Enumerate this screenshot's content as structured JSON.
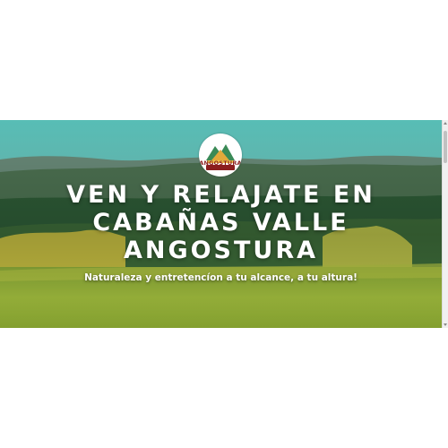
{
  "hero": {
    "logo_text": "ANGOSTURA",
    "headline_lines": [
      "VEN Y RELAJATE EN",
      "CABAÑAS VALLE",
      "ANGOSTURA"
    ],
    "tagline": "Naturaleza y entretencíon a tu alcance, a tu altura!"
  },
  "colors": {
    "sky": "#5ec8c0",
    "grass": "#9cba3a",
    "forest": "#2f5e38",
    "logo_red": "#8b1e1e"
  }
}
